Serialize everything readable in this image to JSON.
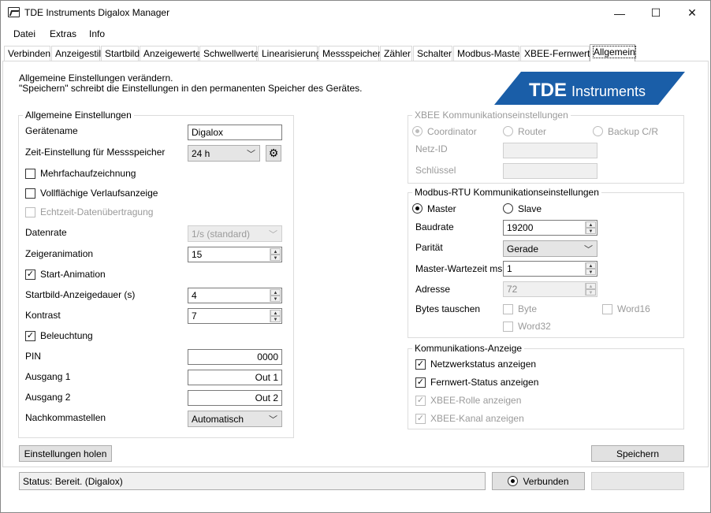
{
  "window": {
    "title": "TDE Instruments Digalox Manager",
    "minimize": "—",
    "maximize": "☐",
    "close": "✕"
  },
  "menu": [
    "Datei",
    "Extras",
    "Info"
  ],
  "tabs": [
    "Verbinden",
    "Anzeigestil",
    "Startbild",
    "Anzeigewerte",
    "Schwellwerte",
    "Linearisierung",
    "Messspeicher",
    "Zähler",
    "Schalter",
    "Modbus-Master",
    "XBEE-Fernwerte",
    "Allgemein"
  ],
  "active_tab": "Allgemein",
  "intro": {
    "line1": "Allgemeine Einstellungen verändern.",
    "line2": "\"Speichern\" schreibt die Einstellungen in den permanenten Speicher des Gerätes."
  },
  "logo": {
    "brand": "TDE",
    "word": "Instruments",
    "color": "#1a5ea8"
  },
  "general": {
    "title": "Allgemeine Einstellungen",
    "device_name_label": "Gerätename",
    "device_name": "Digalox",
    "time_label": "Zeit-Einstellung für Messspeicher",
    "time_value": "24 h",
    "multi_record_label": "Mehrfachaufzeichnung",
    "multi_record_checked": false,
    "fullarea_label": "Vollflächige Verlaufsanzeige",
    "fullarea_checked": false,
    "realtime_label": "Echtzeit-Datenübertragung",
    "realtime_checked": false,
    "datarate_label": "Datenrate",
    "datarate_value": "1/s (standard)",
    "pointer_anim_label": "Zeigeranimation",
    "pointer_anim_value": "15",
    "start_anim_label": "Start-Animation",
    "start_anim_checked": true,
    "startimage_label": "Startbild-Anzeigedauer (s)",
    "startimage_value": "4",
    "contrast_label": "Kontrast",
    "contrast_value": "7",
    "backlight_label": "Beleuchtung",
    "backlight_checked": true,
    "pin_label": "PIN",
    "pin_value": "0000",
    "out1_label": "Ausgang 1",
    "out1_value": "Out 1",
    "out2_label": "Ausgang 2",
    "out2_value": "Out 2",
    "decimals_label": "Nachkommastellen",
    "decimals_value": "Automatisch"
  },
  "xbee": {
    "title": "XBEE Kommunikationseinstellungen",
    "coordinator": "Coordinator",
    "router": "Router",
    "backup": "Backup C/R",
    "selected": "Coordinator",
    "netid_label": "Netz-ID",
    "netid_value": "",
    "key_label": "Schlüssel",
    "key_value": ""
  },
  "modbus": {
    "title": "Modbus-RTU Kommunikationseinstellungen",
    "master": "Master",
    "slave": "Slave",
    "selected": "Master",
    "baud_label": "Baudrate",
    "baud_value": "19200",
    "parity_label": "Parität",
    "parity_value": "Gerade",
    "wait_label": "Master-Wartezeit ms",
    "wait_value": "1",
    "address_label": "Adresse",
    "address_value": "72",
    "swap_label": "Bytes tauschen",
    "byte_label": "Byte",
    "word16_label": "Word16",
    "word32_label": "Word32"
  },
  "comm": {
    "title": "Kommunikations-Anzeige",
    "network_label": "Netzwerkstatus anzeigen",
    "network_checked": true,
    "remote_label": "Fernwert-Status anzeigen",
    "remote_checked": true,
    "xbee_role_label": "XBEE-Rolle anzeigen",
    "xbee_role_checked": true,
    "xbee_channel_label": "XBEE-Kanal anzeigen",
    "xbee_channel_checked": true
  },
  "buttons": {
    "fetch": "Einstellungen holen",
    "save": "Speichern",
    "connected": "Verbunden",
    "right_blank": ""
  },
  "status": {
    "text": "Status: Bereit. (Digalox)"
  }
}
